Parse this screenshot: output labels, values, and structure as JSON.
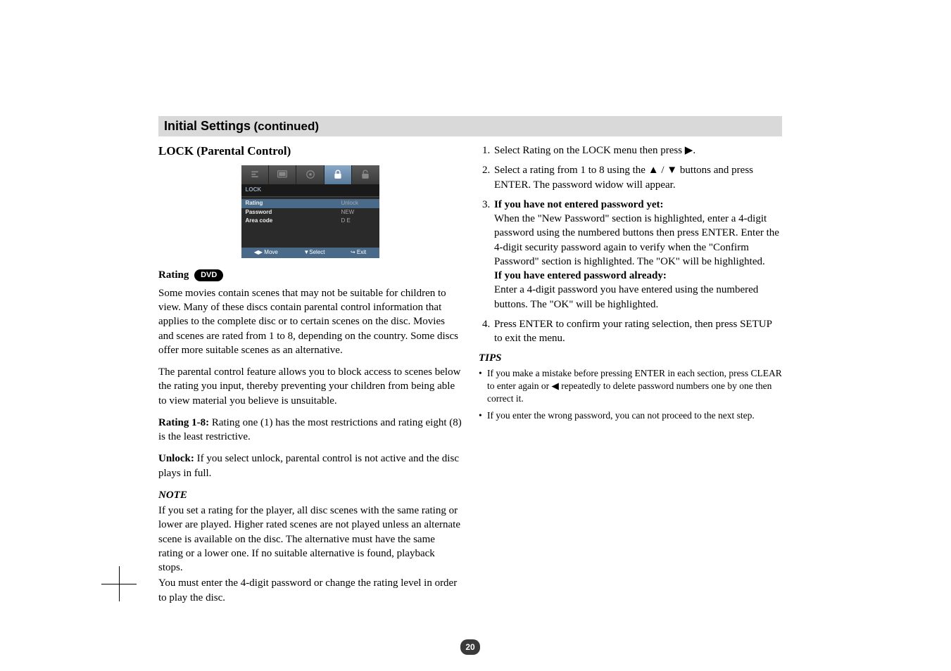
{
  "titleBar": {
    "main": "Initial Settings",
    "cont": "(continued)"
  },
  "left": {
    "heading": "LOCK (Parental Control)",
    "ratingHead": "Rating",
    "dvd": "DVD",
    "p1": "Some movies contain scenes that may not be suitable for children to view. Many of these discs contain parental control information that applies to the complete disc or to certain scenes on the disc. Movies and scenes are rated from 1 to 8, depending on the country. Some discs offer more suitable scenes as an alternative.",
    "p2": "The parental control feature allows you to block access to scenes below the rating you input, thereby preventing your children from being able to view material you believe is unsuitable.",
    "r18a": "Rating 1-8:",
    "r18b": " Rating one (1) has the most restrictions and rating eight (8) is the least restrictive.",
    "unA": "Unlock:",
    "unB": " If you select unlock, parental control is not active and the disc plays in full.",
    "noteHead": "NOTE",
    "noteBody": "If you set a rating for the player, all disc scenes with the same rating or lower are played. Higher rated scenes are not played unless an alternate scene is available on the disc. The alternative must have the same rating or a lower one. If no suitable alternative is found, playback stops.",
    "noteBody2": "You must enter the 4-digit password or change the rating level in order to play the disc."
  },
  "osd": {
    "category": "LOCK",
    "rows": [
      {
        "label": "Rating",
        "value": "Unlock"
      },
      {
        "label": "Password",
        "value": "NEW"
      },
      {
        "label": "Area code",
        "value": "D E"
      }
    ],
    "footMove": "Move",
    "footSelect": "Select",
    "footExit": "Exit"
  },
  "right": {
    "s1a": "Select Rating on the LOCK menu then press ",
    "s1b": ".",
    "s2a": "Select a rating from 1 to 8 using the ",
    "s2b": " buttons and press ENTER. The password widow will appear.",
    "s3head": "If you have not entered password yet:",
    "s3body": "When the \"New Password\" section is highlighted, enter a 4-digit password using the numbered buttons then press ENTER. Enter the 4-digit security password again to verify when the \"Confirm Password\" section is highlighted. The \"OK\" will be highlighted.",
    "s3head2": "If you have entered password already:",
    "s3body2": "Enter a 4-digit password you have entered using the numbered buttons. The \"OK\" will be highlighted.",
    "s4": "Press ENTER to confirm your rating selection, then press SETUP to exit the menu.",
    "tipsHead": "TIPS",
    "tip1a": "If you make a mistake before pressing ENTER in each section, press CLEAR to enter again or ",
    "tip1b": " repeatedly to delete password numbers one by one then correct it.",
    "tip2": "If you enter the wrong password, you can not proceed to the next step."
  },
  "glyphs": {
    "right": "▶",
    "left": "◀",
    "up": "▲",
    "down": "▼",
    "slash": " / ",
    "move": "◀▶",
    "return": "↪"
  },
  "pageNum": "20"
}
